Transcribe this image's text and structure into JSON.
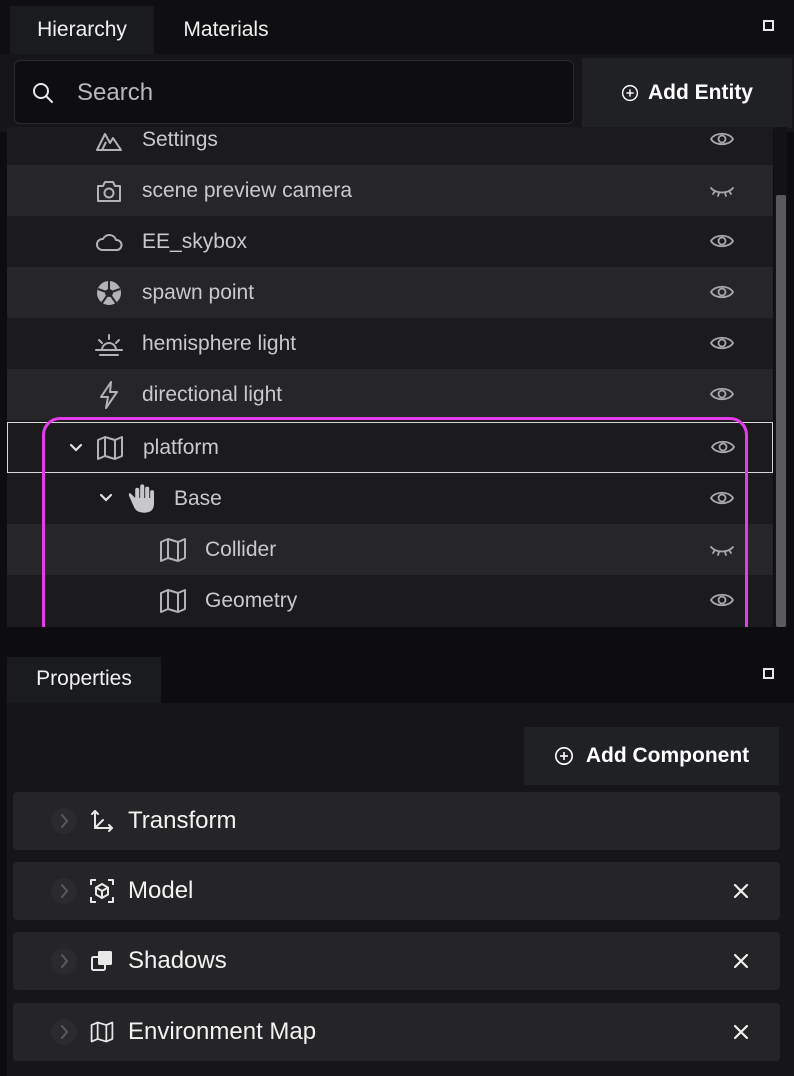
{
  "tabs": {
    "hierarchy": "Hierarchy",
    "materials": "Materials"
  },
  "search": {
    "placeholder": "Search"
  },
  "add_entity_label": "Add Entity",
  "hierarchy_items": [
    {
      "label": "Settings",
      "icon": "mountain-icon",
      "visibility": "eye-icon"
    },
    {
      "label": "scene preview camera",
      "icon": "camera-icon",
      "visibility": "eye-closed-icon"
    },
    {
      "label": "EE_skybox",
      "icon": "cloud-icon",
      "visibility": "eye-icon"
    },
    {
      "label": "spawn point",
      "icon": "aperture-icon",
      "visibility": "eye-icon"
    },
    {
      "label": "hemisphere light",
      "icon": "sunrise-icon",
      "visibility": "eye-icon"
    },
    {
      "label": "directional light",
      "icon": "lightning-icon",
      "visibility": "eye-icon"
    },
    {
      "label": "platform",
      "icon": "map-icon",
      "visibility": "eye-icon",
      "expanded": true,
      "selected": true
    },
    {
      "label": "Base",
      "icon": "hand-icon",
      "visibility": "eye-icon",
      "expanded": true
    },
    {
      "label": "Collider",
      "icon": "map-icon",
      "visibility": "eye-closed-icon"
    },
    {
      "label": "Geometry",
      "icon": "map-icon",
      "visibility": "eye-icon"
    }
  ],
  "properties_tab": "Properties",
  "add_component_label": "Add Component",
  "components": [
    {
      "label": "Transform",
      "icon": "axes-icon",
      "removable": false
    },
    {
      "label": "Model",
      "icon": "cube-scan-icon",
      "removable": true
    },
    {
      "label": "Shadows",
      "icon": "shadow-copy-icon",
      "removable": true
    },
    {
      "label": "Environment Map",
      "icon": "map-icon",
      "removable": true
    }
  ],
  "colors": {
    "highlight": "#e23de8",
    "panel": "#1c1c1e",
    "row_alt": "#262628"
  }
}
